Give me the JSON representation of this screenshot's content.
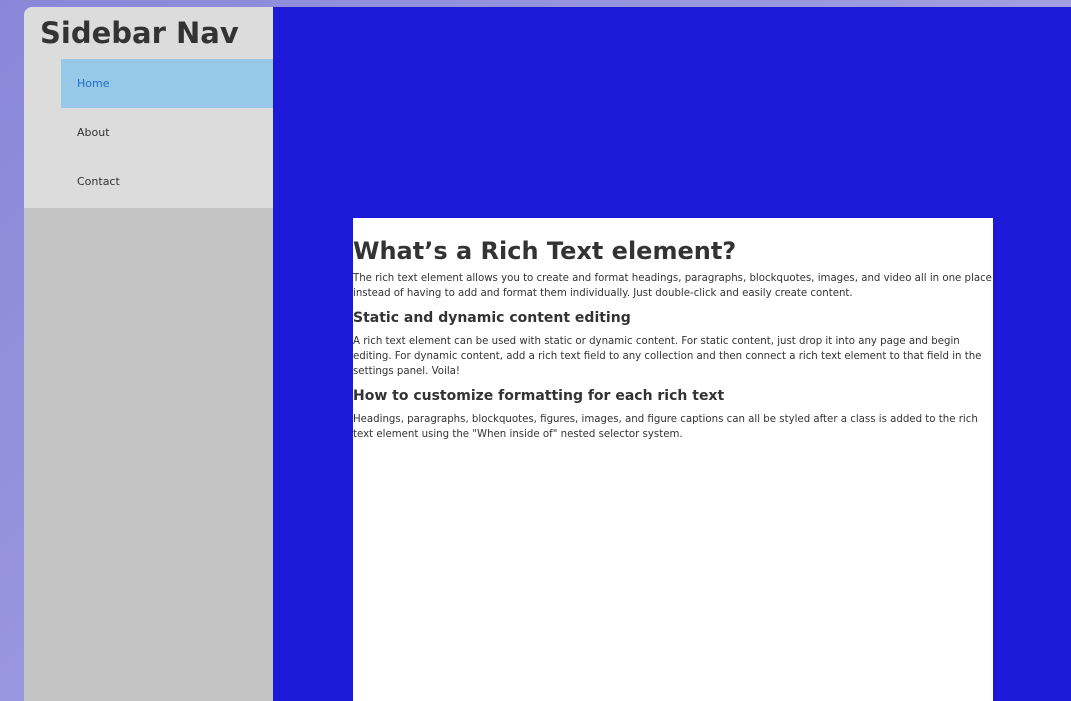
{
  "sidebar": {
    "brand": "Sidebar Nav",
    "items": [
      {
        "label": "Home",
        "active": true
      },
      {
        "label": "About",
        "active": false
      },
      {
        "label": "Contact",
        "active": false
      }
    ]
  },
  "content": {
    "heading": "What’s a Rich Text element?",
    "intro": "The rich text element allows you to create and format headings, paragraphs, blockquotes, images, and video all in one place instead of having to add and format them individually. Just double-click and easily create content.",
    "section1_heading": "Static and dynamic content editing",
    "section1_body": "A rich text element can be used with static or dynamic content. For static content, just drop it into any page and begin editing. For dynamic content, add a rich text field to any collection and then connect a rich text element to that field in the settings panel. Voila!",
    "section2_heading": "How to customize formatting for each rich text",
    "section2_body": "Headings, paragraphs, blockquotes, figures, images, and figure captions can all be styled after a class is added to the rich text element using the \"When inside of\" nested selector system."
  },
  "colors": {
    "main_background": "#1d19d9",
    "sidebar_background": "#c4c4c4",
    "sidebar_top_background": "#dcdcdc",
    "active_item_background": "#98c8e8",
    "active_item_text": "#1a6fc9"
  }
}
